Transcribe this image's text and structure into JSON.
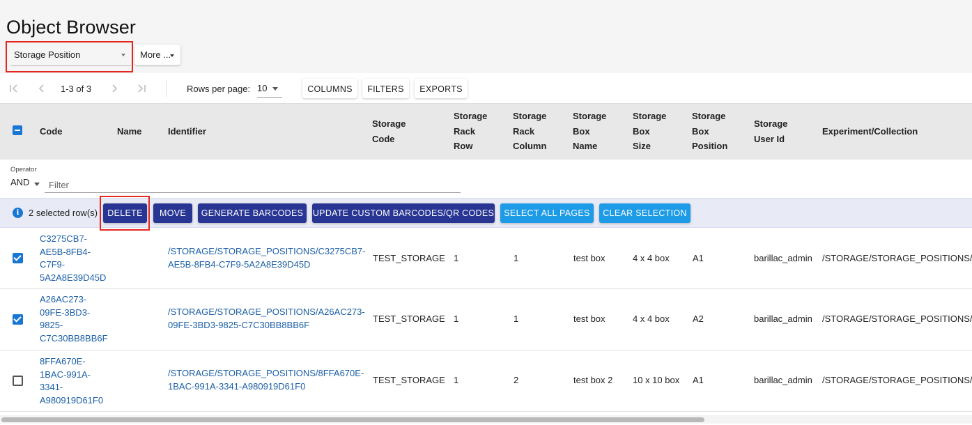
{
  "page": {
    "title": "Object Browser"
  },
  "selector": {
    "object_type": "Storage Position",
    "more_label": "More ..."
  },
  "pagination": {
    "range": "1-3 of 3",
    "rows_per_page_label": "Rows per page:",
    "rows_per_page_value": "10",
    "buttons": [
      "COLUMNS",
      "FILTERS",
      "EXPORTS"
    ]
  },
  "columns": {
    "code": "Code",
    "name": "Name",
    "identifier": "Identifier",
    "storage_code": [
      "Storage",
      "Code"
    ],
    "rack_row": [
      "Storage",
      "Rack",
      "Row"
    ],
    "rack_column": [
      "Storage",
      "Rack",
      "Column"
    ],
    "box_name": [
      "Storage",
      "Box",
      "Name"
    ],
    "box_size": [
      "Storage",
      "Box",
      "Size"
    ],
    "box_position": [
      "Storage",
      "Box",
      "Position"
    ],
    "user_id": [
      "Storage",
      "User Id"
    ],
    "experiment": "Experiment/Collection"
  },
  "filter": {
    "operator_label": "Operator",
    "operator_value": "AND",
    "placeholder": "Filter"
  },
  "selection": {
    "count_text": "2 selected row(s)",
    "actions": [
      "DELETE",
      "MOVE",
      "GENERATE BARCODES",
      "UPDATE CUSTOM BARCODES/QR CODES",
      "SELECT ALL PAGES",
      "CLEAR SELECTION"
    ]
  },
  "rows": [
    {
      "checked": true,
      "code": [
        "C3275CB7-",
        "AE5B-8FB4-",
        "C7F9-",
        "5A2A8E39D45D"
      ],
      "identifier": [
        "/STORAGE/STORAGE_POSITIONS/C3275CB7-",
        "AE5B-8FB4-C7F9-5A2A8E39D45D"
      ],
      "storage_code": "TEST_STORAGE",
      "rack_row": "1",
      "rack_column": "1",
      "box_name": "test box",
      "box_size": "4 x 4 box",
      "box_position": "A1",
      "user_id": "barillac_admin",
      "experiment": "/STORAGE/STORAGE_POSITIONS/S"
    },
    {
      "checked": true,
      "code": [
        "A26AC273-",
        "09FE-3BD3-",
        "9825-",
        "C7C30BB8BB6F"
      ],
      "identifier": [
        "/STORAGE/STORAGE_POSITIONS/A26AC273-",
        "09FE-3BD3-9825-C7C30BB8BB6F"
      ],
      "storage_code": "TEST_STORAGE",
      "rack_row": "1",
      "rack_column": "1",
      "box_name": "test box",
      "box_size": "4 x 4 box",
      "box_position": "A2",
      "user_id": "barillac_admin",
      "experiment": "/STORAGE/STORAGE_POSITIONS/S"
    },
    {
      "checked": false,
      "code": [
        "8FFA670E-",
        "1BAC-991A-",
        "3341-",
        "A980919D61F0"
      ],
      "identifier": [
        "/STORAGE/STORAGE_POSITIONS/8FFA670E-",
        "1BAC-991A-3341-A980919D61F0"
      ],
      "storage_code": "TEST_STORAGE",
      "rack_row": "1",
      "rack_column": "2",
      "box_name": "test box 2",
      "box_size": "10 x 10 box",
      "box_position": "A1",
      "user_id": "barillac_admin",
      "experiment": "/STORAGE/STORAGE_POSITIONS/S"
    }
  ]
}
